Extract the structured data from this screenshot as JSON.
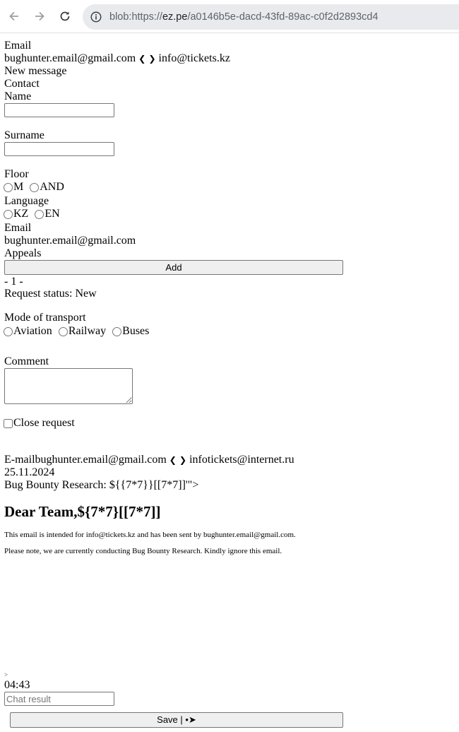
{
  "browser": {
    "url_scheme": "blob:https://",
    "url_host": "ez.pe",
    "url_path": "/a0146b5e-dacd-43fd-89ac-c0f2d2893cd4"
  },
  "header": {
    "label": "Email",
    "from": "bughunter.email@gmail.com",
    "arrows": "❮ ❯",
    "to": "info@tickets.kz",
    "new_message": "New message",
    "contact": "Contact"
  },
  "form": {
    "name_label": "Name",
    "surname_label": "Surname",
    "floor_label": "Floor",
    "floor_options": [
      "M",
      "AND"
    ],
    "language_label": "Language",
    "language_options": [
      "KZ",
      "EN"
    ],
    "email_label": "Email",
    "email_value": "bughunter.email@gmail.com",
    "appeals_label": "Appeals",
    "add_button": "Add",
    "page_marker": "- 1 -",
    "request_status": "Request status: New",
    "transport_label": "Mode of transport",
    "transport_options": [
      "Aviation",
      "Railway",
      "Buses"
    ],
    "comment_label": "Comment",
    "close_request_label": "Close request"
  },
  "message": {
    "email_prefix": "E-mail",
    "from": "bughunter.email@gmail.com",
    "arrows": "❮ ❯",
    "to": "infotickets@internet.ru",
    "date": "25.11.2024",
    "subject": "Bug Bounty Research: ${{7*7}}[[7*7]]'\">",
    "greeting": "Dear Team,${7*7}[[7*7]]",
    "body_line1": "This email is intended for info@tickets.kz and has been sent by bughunter.email@gmail.com.",
    "body_line2": "Please note, we are currently conducting Bug Bounty Research. Kindly ignore this email."
  },
  "footer": {
    "chevron": ">",
    "time": "04:43",
    "chat_placeholder": "Chat result",
    "save_button": "Save | •➤"
  }
}
